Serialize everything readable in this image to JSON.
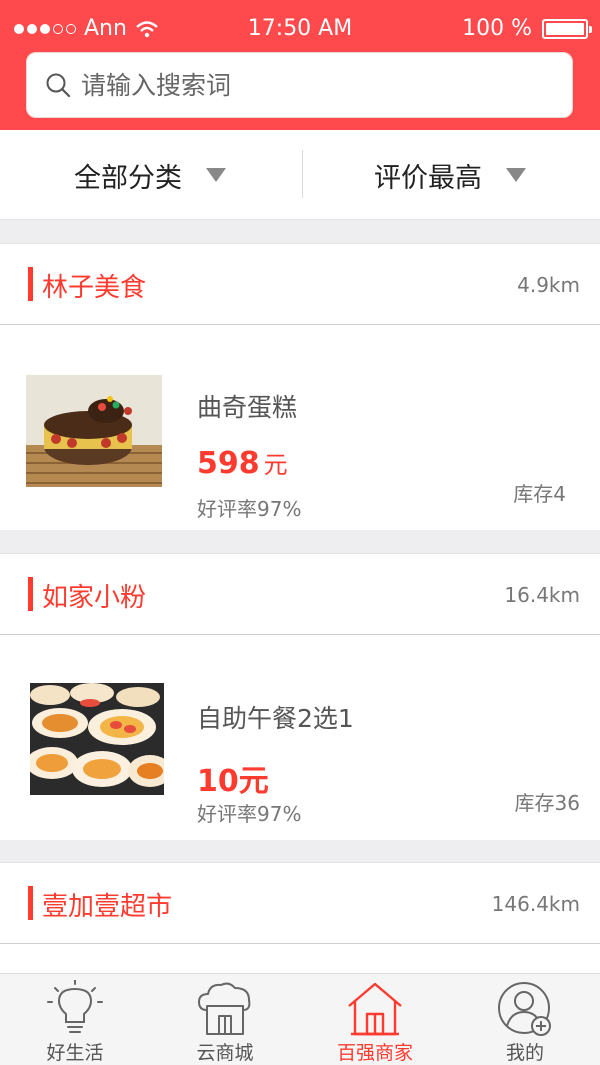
{
  "status_bar": {
    "carrier": "Ann",
    "time": "17:50 AM",
    "battery": "100 %",
    "battery_level": 1.0
  },
  "search": {
    "placeholder": "请输入搜索词",
    "icon": "search-icon"
  },
  "filters": [
    {
      "label": "全部分类",
      "icon": "caret-down-icon"
    },
    {
      "label": "评价最高",
      "icon": "caret-down-icon"
    }
  ],
  "shops": [
    {
      "name": "林子美食",
      "distance": "4.9km",
      "product": {
        "name": "曲奇蛋糕",
        "price": "598",
        "unit": "元",
        "rating": "好评率97%",
        "stock": "库存4"
      }
    },
    {
      "name": "如家小粉",
      "distance": "16.4km",
      "product": {
        "name": "自助午餐2选1",
        "price": "10",
        "unit": "元",
        "rating": "好评率97%",
        "stock": "库存36"
      }
    },
    {
      "name": "壹加壹超市",
      "distance": "146.4km"
    }
  ],
  "tabbar": [
    {
      "label": "好生活",
      "icon": "lightbulb-icon",
      "active": false
    },
    {
      "label": "云商城",
      "icon": "cloud-store-icon",
      "active": false
    },
    {
      "label": "百强商家",
      "icon": "house-icon",
      "active": true
    },
    {
      "label": "我的",
      "icon": "user-add-icon",
      "active": false
    }
  ],
  "colors": {
    "brand": "#ff4a4d",
    "accent": "#ff3b30"
  }
}
